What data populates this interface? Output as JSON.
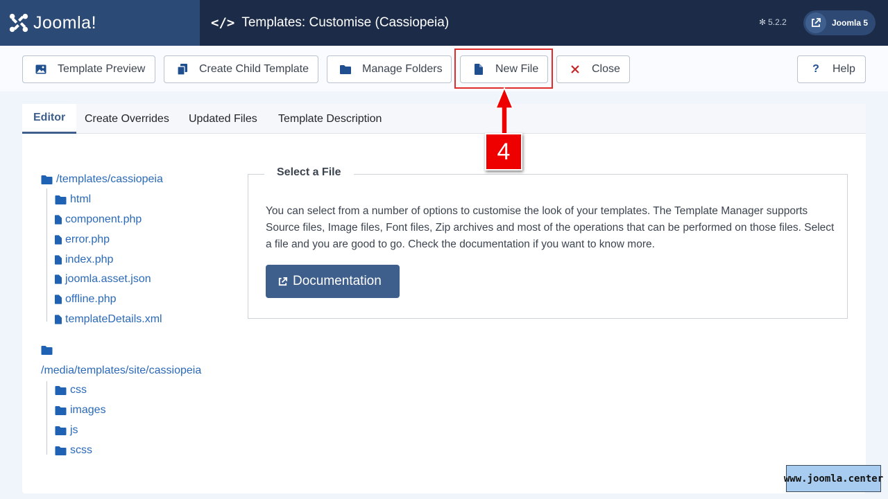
{
  "header": {
    "logo_text": "Joomla!",
    "page_title": "Templates: Customise (Cassiopeia)",
    "version": "5.2.2",
    "site_button": "Joomla 5"
  },
  "toolbar": {
    "buttons": [
      {
        "label": "Template Preview",
        "icon": "image-icon"
      },
      {
        "label": "Create Child Template",
        "icon": "copy-icon"
      },
      {
        "label": "Manage Folders",
        "icon": "folder-icon"
      },
      {
        "label": "New File",
        "icon": "file-icon"
      },
      {
        "label": "Close",
        "icon": "close-icon"
      },
      {
        "label": "Help",
        "icon": "question-icon"
      }
    ]
  },
  "tabs": [
    "Editor",
    "Create Overrides",
    "Updated Files",
    "Template Description"
  ],
  "tree": {
    "root1": "/templates/cassiopeia",
    "root1_children": [
      "html",
      "component.php",
      "error.php",
      "index.php",
      "joomla.asset.json",
      "offline.php",
      "templateDetails.xml"
    ],
    "root2": "/media/templates/site/cassiopeia",
    "root2_children": [
      "css",
      "images",
      "js",
      "scss"
    ]
  },
  "select_file": {
    "legend": "Select a File",
    "description": "You can select from a number of options to customise the look of your templates. The Template Manager supports Source files, Image files, Font files, Zip archives and most of the operations that can be performed on those files. Select a file and you are good to go. Check the documentation if you want to know more.",
    "doc_button": "Documentation"
  },
  "callout_number": "4",
  "watermark": "www.joomla.center",
  "colors": {
    "header_bg": "#1c2b47",
    "accent": "#3e5e8c",
    "link": "#2a69b8",
    "callout": "#ee0000"
  }
}
